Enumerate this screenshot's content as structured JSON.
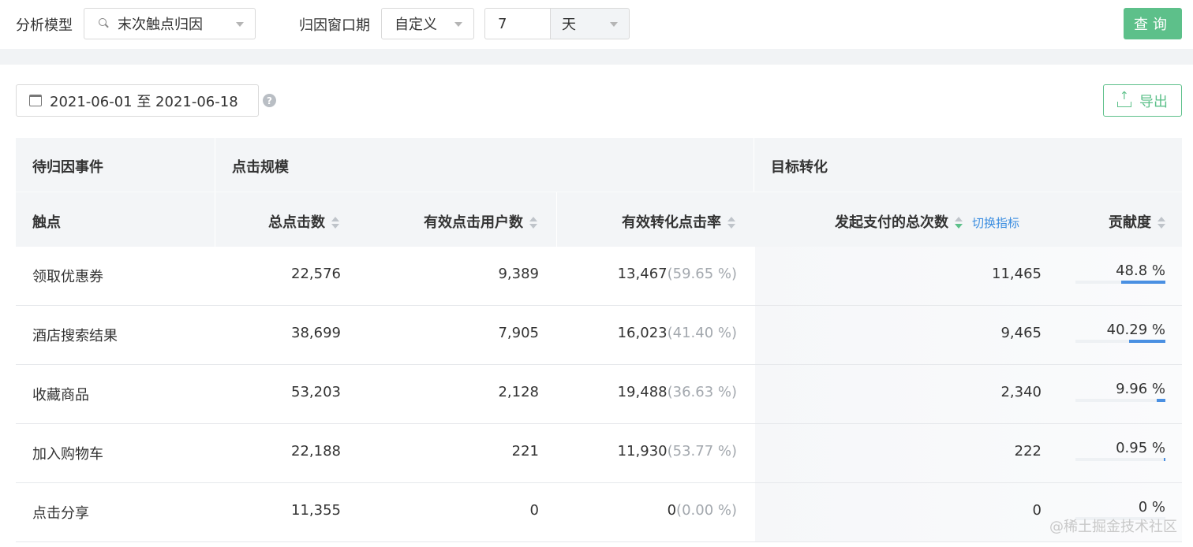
{
  "filters": {
    "model_label": "分析模型",
    "model_value": "末次触点归因",
    "window_label": "归因窗口期",
    "window_mode": "自定义",
    "window_number": "7",
    "window_unit": "天",
    "query_button": "查询"
  },
  "toolbar": {
    "date_range": "2021-06-01 至 2021-06-18",
    "help_icon": "?",
    "export_button": "导出"
  },
  "table": {
    "group_headers": [
      "待归因事件",
      "点击规模",
      "目标转化"
    ],
    "columns": {
      "touchpoint": "触点",
      "total_clicks": "总点击数",
      "valid_users": "有效点击用户数",
      "conv_rate": "有效转化点击率",
      "payments": "发起支付的总次数",
      "switch_metric": "切换指标",
      "contribution": "贡献度"
    },
    "rows": [
      {
        "name": "领取优惠券",
        "total": "22,576",
        "users": "9,389",
        "conv": "13,467",
        "conv_pct": "(59.65 %)",
        "pay": "11,465",
        "contrib": "48.8 %",
        "contrib_value": 0.488
      },
      {
        "name": "酒店搜索结果",
        "total": "38,699",
        "users": "7,905",
        "conv": "16,023",
        "conv_pct": "(41.40 %)",
        "pay": "9,465",
        "contrib": "40.29 %",
        "contrib_value": 0.4029
      },
      {
        "name": "收藏商品",
        "total": "53,203",
        "users": "2,128",
        "conv": "19,488",
        "conv_pct": "(36.63 %)",
        "pay": "2,340",
        "contrib": "9.96 %",
        "contrib_value": 0.0996
      },
      {
        "name": "加入购物车",
        "total": "22,188",
        "users": "221",
        "conv": "11,930",
        "conv_pct": "(53.77 %)",
        "pay": "222",
        "contrib": "0.95 %",
        "contrib_value": 0.0095
      },
      {
        "name": "点击分享",
        "total": "11,355",
        "users": "0",
        "conv": "0",
        "conv_pct": "(0.00 %)",
        "pay": "0",
        "contrib": "0 %",
        "contrib_value": 0
      }
    ]
  },
  "watermark": "@稀土掘金技术社区",
  "colors": {
    "accent": "#5dc08a",
    "link": "#3a8de0",
    "bar": "#4a90e2"
  }
}
